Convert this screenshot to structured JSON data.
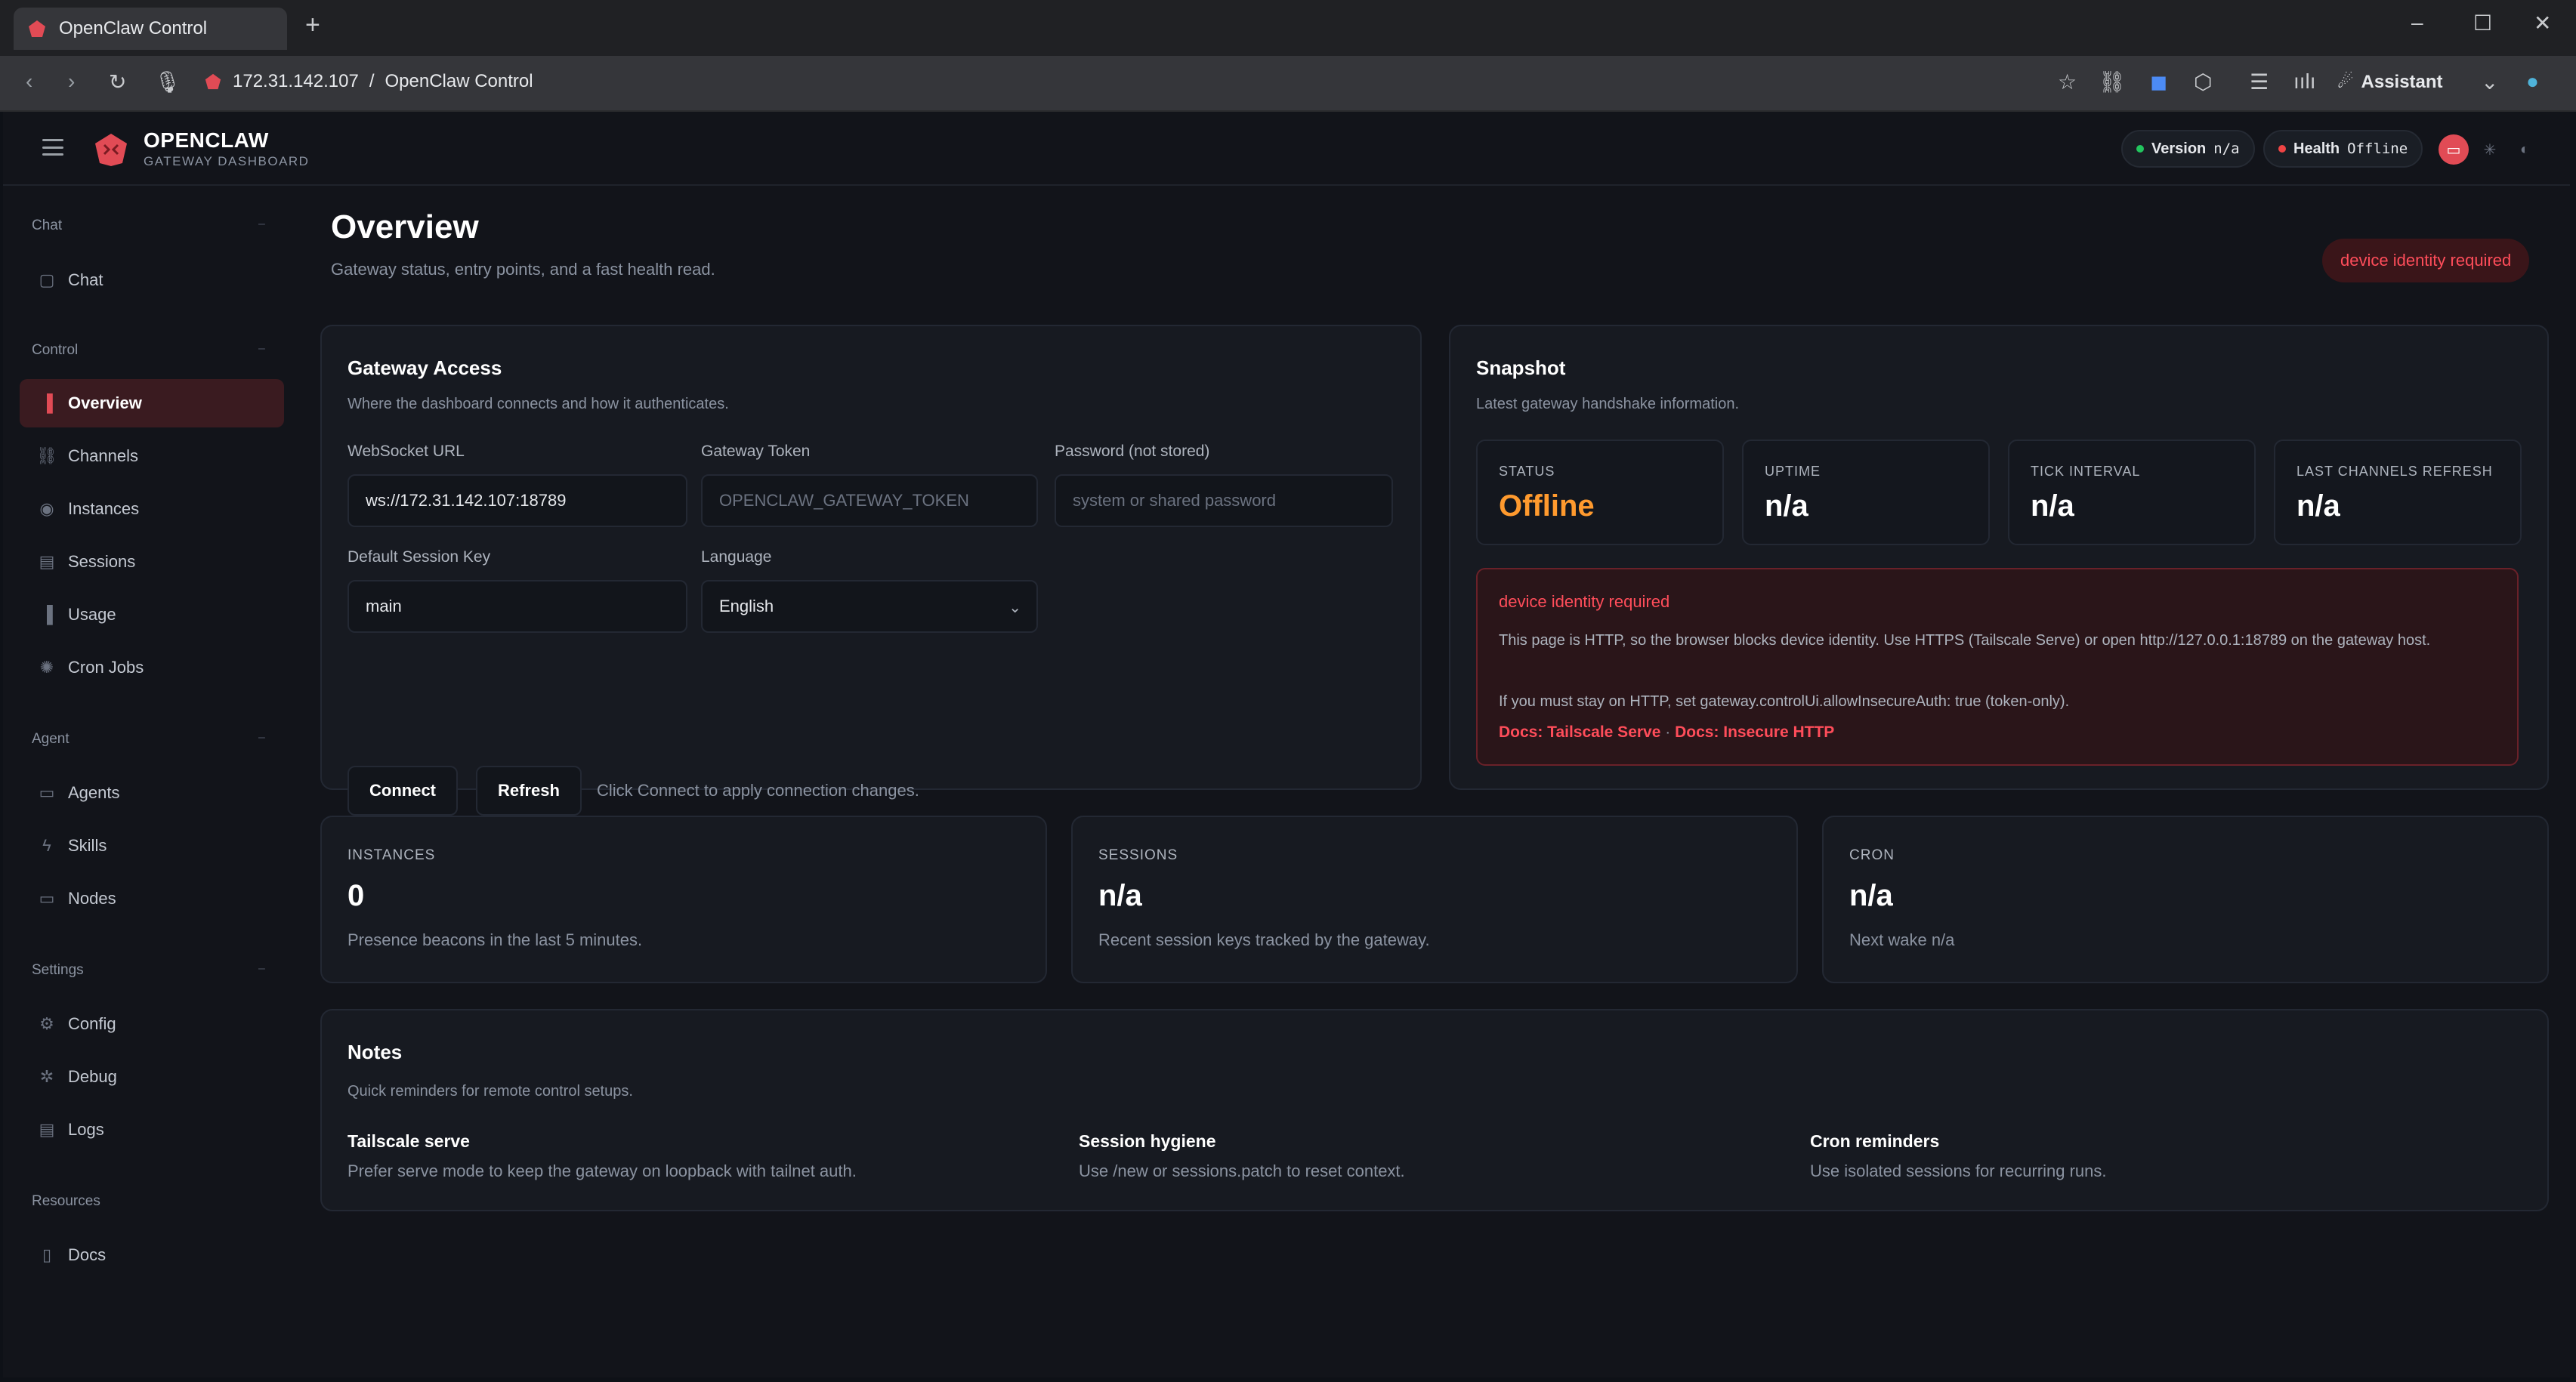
{
  "browser": {
    "tab_title": "OpenClaw Control",
    "new_tab": "+",
    "url_host": "172.31.142.107",
    "url_sep": "/",
    "url_title": "OpenClaw Control",
    "assistant_label": "Assistant",
    "window_controls": [
      "minimize",
      "maximize",
      "close"
    ]
  },
  "header": {
    "brand_name": "OPENCLAW",
    "brand_sub": "GATEWAY DASHBOARD",
    "version_label": "Version",
    "version_value": "n/a",
    "health_label": "Health",
    "health_value": "Offline",
    "colors": {
      "accent": "#e14b55",
      "ok": "#22c55e",
      "bad": "#ef4444"
    }
  },
  "sidebar": {
    "groups": [
      {
        "label": "Chat",
        "items": [
          {
            "label": "Chat",
            "icon": "chat-icon"
          }
        ]
      },
      {
        "label": "Control",
        "items": [
          {
            "label": "Overview",
            "icon": "bar-chart-icon",
            "active": true
          },
          {
            "label": "Channels",
            "icon": "link-icon"
          },
          {
            "label": "Instances",
            "icon": "radio-icon"
          },
          {
            "label": "Sessions",
            "icon": "file-icon"
          },
          {
            "label": "Usage",
            "icon": "bar-chart-icon"
          },
          {
            "label": "Cron Jobs",
            "icon": "loader-icon"
          }
        ]
      },
      {
        "label": "Agent",
        "items": [
          {
            "label": "Agents",
            "icon": "folder-icon"
          },
          {
            "label": "Skills",
            "icon": "zap-icon"
          },
          {
            "label": "Nodes",
            "icon": "monitor-icon"
          }
        ]
      },
      {
        "label": "Settings",
        "items": [
          {
            "label": "Config",
            "icon": "gear-icon"
          },
          {
            "label": "Debug",
            "icon": "bug-icon"
          },
          {
            "label": "Logs",
            "icon": "logs-icon"
          }
        ]
      },
      {
        "label": "Resources",
        "items": [
          {
            "label": "Docs",
            "icon": "book-icon"
          }
        ]
      }
    ]
  },
  "page": {
    "title": "Overview",
    "subtitle": "Gateway status, entry points, and a fast health read.",
    "error_badge": "device identity required"
  },
  "gateway_access": {
    "title": "Gateway Access",
    "subtitle": "Where the dashboard connects and how it authenticates.",
    "ws_label": "WebSocket URL",
    "ws_value": "ws://172.31.142.107:18789",
    "token_label": "Gateway Token",
    "token_placeholder": "OPENCLAW_GATEWAY_TOKEN",
    "password_label": "Password (not stored)",
    "password_placeholder": "system or shared password",
    "session_label": "Default Session Key",
    "session_value": "main",
    "language_label": "Language",
    "language_value": "English",
    "connect_label": "Connect",
    "refresh_label": "Refresh",
    "hint": "Click Connect to apply connection changes."
  },
  "snapshot": {
    "title": "Snapshot",
    "subtitle": "Latest gateway handshake information.",
    "stats": [
      {
        "label": "STATUS",
        "value": "Offline"
      },
      {
        "label": "UPTIME",
        "value": "n/a"
      },
      {
        "label": "TICK INTERVAL",
        "value": "n/a"
      },
      {
        "label": "LAST CHANNELS REFRESH",
        "value": "n/a"
      }
    ],
    "alert": {
      "title": "device identity required",
      "text": "This page is HTTP, so the browser blocks device identity. Use HTTPS (Tailscale Serve) or open http://127.0.0.1:18789 on the gateway host.",
      "text2": "If you must stay on HTTP, set gateway.controlUi.allowInsecureAuth: true (token-only).",
      "link1": "Docs: Tailscale Serve",
      "link_sep": "·",
      "link2": "Docs: Insecure HTTP"
    }
  },
  "metrics": [
    {
      "label": "INSTANCES",
      "value": "0",
      "sub": "Presence beacons in the last 5 minutes."
    },
    {
      "label": "SESSIONS",
      "value": "n/a",
      "sub": "Recent session keys tracked by the gateway."
    },
    {
      "label": "CRON",
      "value": "n/a",
      "sub": "Next wake n/a"
    }
  ],
  "notes": {
    "title": "Notes",
    "subtitle": "Quick reminders for remote control setups.",
    "items": [
      {
        "title": "Tailscale serve",
        "text": "Prefer serve mode to keep the gateway on loopback with tailnet auth."
      },
      {
        "title": "Session hygiene",
        "text": "Use /new or sessions.patch to reset context."
      },
      {
        "title": "Cron reminders",
        "text": "Use isolated sessions for recurring runs."
      }
    ]
  }
}
